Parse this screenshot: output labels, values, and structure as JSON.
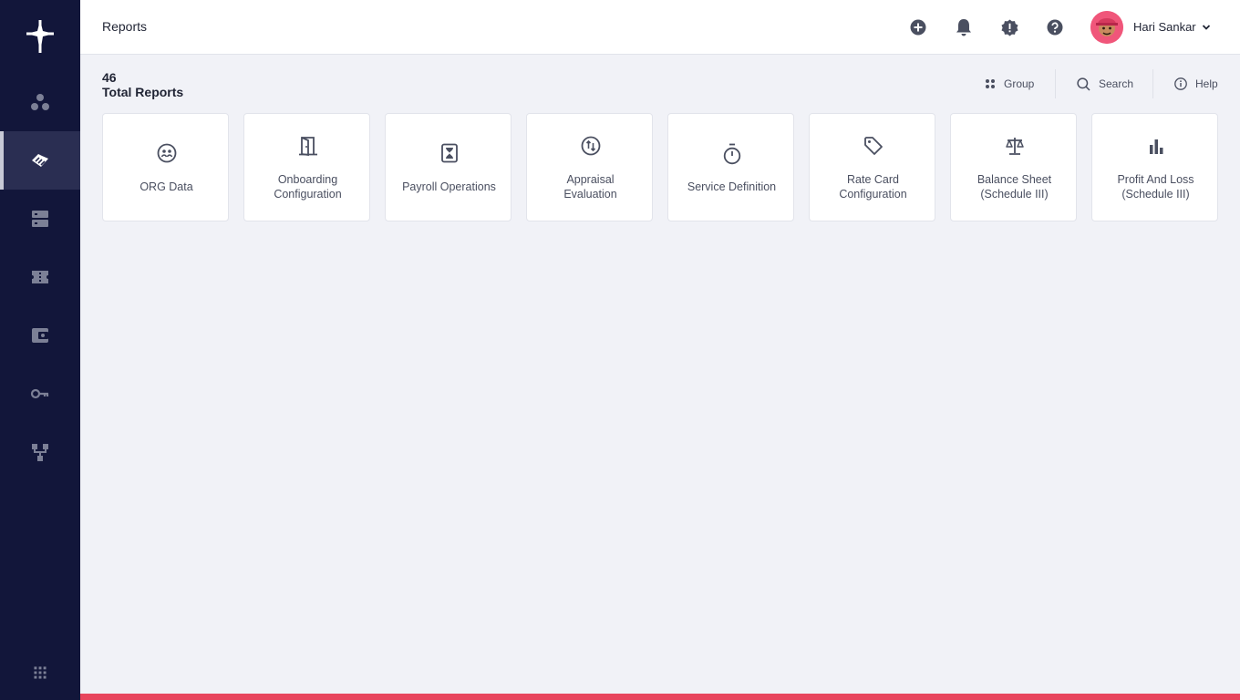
{
  "header": {
    "title": "Reports",
    "user_name": "Hari Sankar"
  },
  "summary": {
    "count": "46",
    "label": "Total Reports"
  },
  "toolbar": {
    "group_label": "Group",
    "search_label": "Search",
    "help_label": "Help"
  },
  "cards": [
    {
      "line1": "ORG Data",
      "line2": ""
    },
    {
      "line1": "Onboarding",
      "line2": "Configuration"
    },
    {
      "line1": "Payroll Operations",
      "line2": ""
    },
    {
      "line1": "Appraisal",
      "line2": "Evaluation"
    },
    {
      "line1": "Service Definition",
      "line2": ""
    },
    {
      "line1": "Rate Card",
      "line2": "Configuration"
    },
    {
      "line1": "Balance Sheet",
      "line2": "(Schedule III)"
    },
    {
      "line1": "Profit And Loss",
      "line2": "(Schedule III)"
    }
  ],
  "colors": {
    "sidebar": "#12163a",
    "accent": "#e8455d",
    "background": "#f1f2f7"
  }
}
